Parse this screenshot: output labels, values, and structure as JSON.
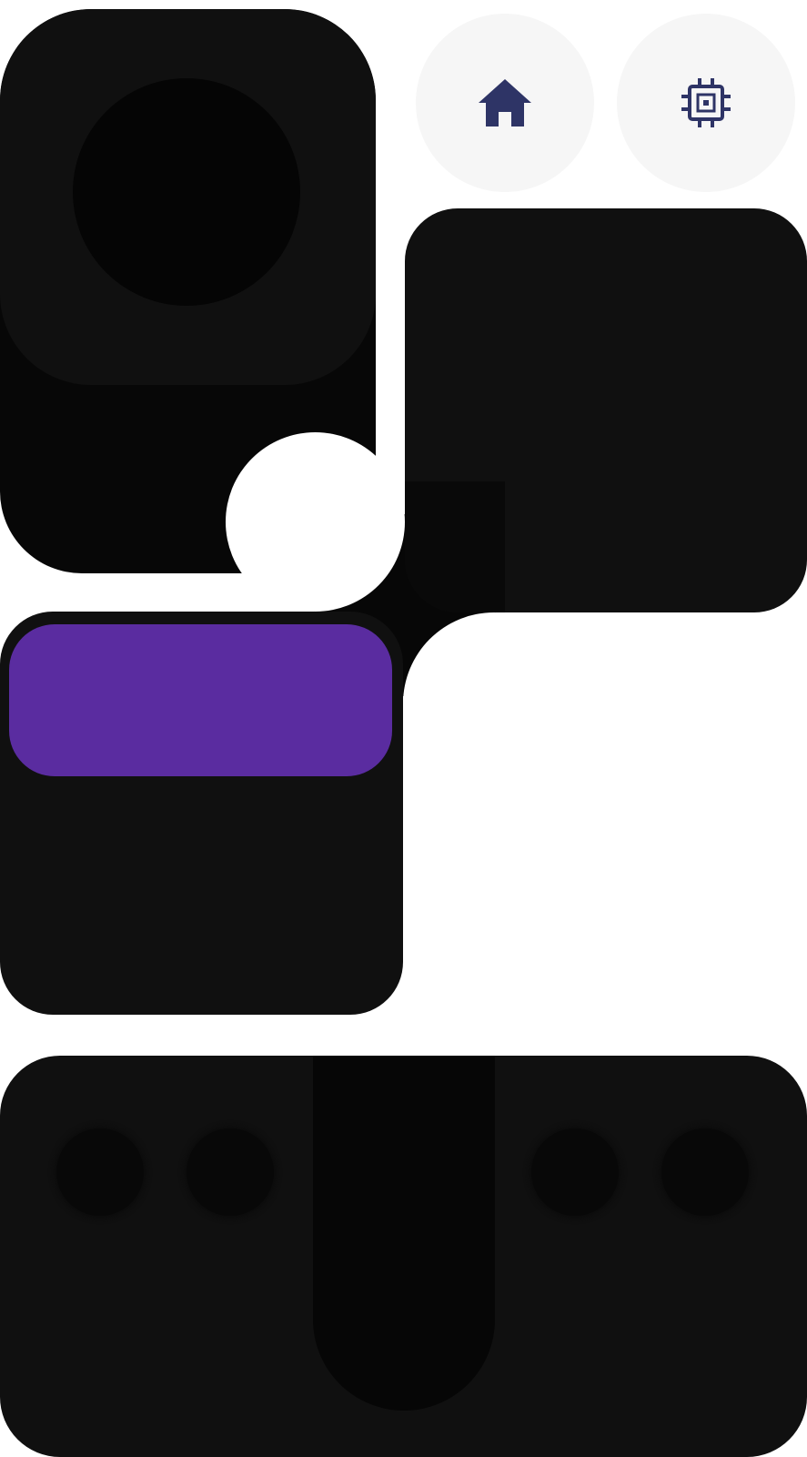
{
  "icons": {
    "home": "home-icon",
    "chip": "cpu-chip-icon"
  },
  "colors": {
    "background": "#ffffff",
    "panel": "#101010",
    "panel_dark": "#070707",
    "round_button": "#f6f6f6",
    "icon_navy": "#2e3466",
    "accent_purple": "#5a2ca0"
  }
}
